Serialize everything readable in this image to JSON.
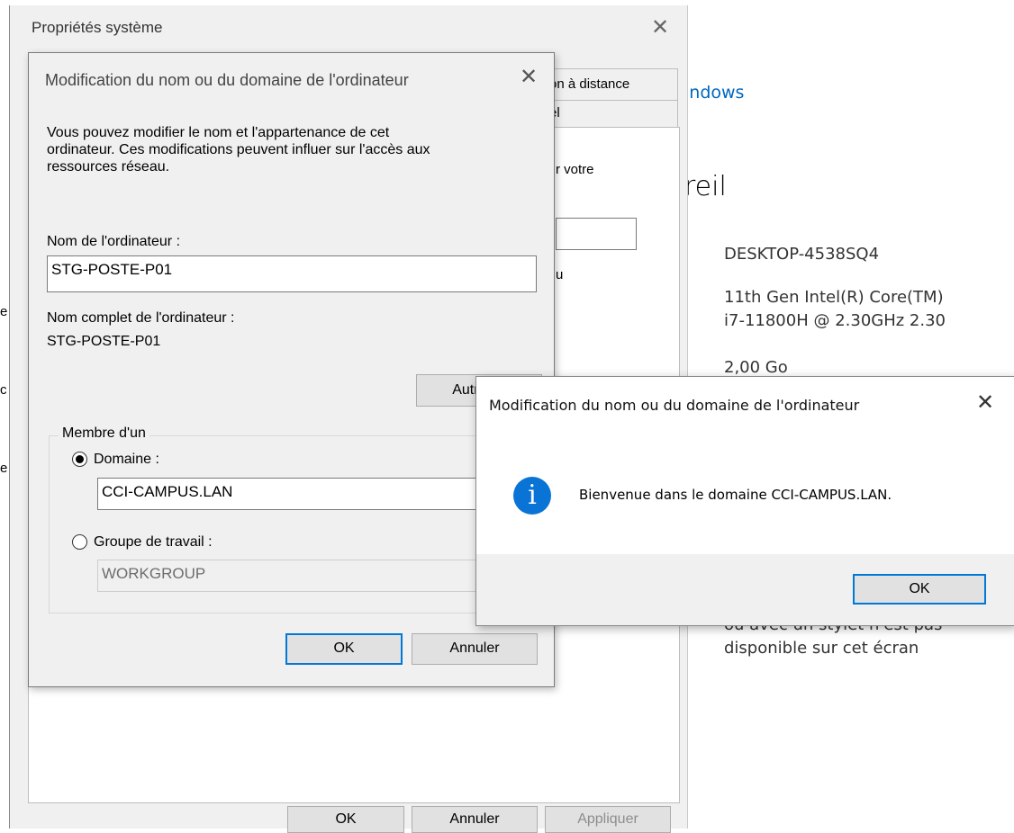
{
  "settings": {
    "link_text": "indows",
    "heading": "reil",
    "device_name": "DESKTOP-4538SQ4",
    "processor_line1": "11th Gen Intel(R) Core(TM)",
    "processor_line2": "i7-11800H @ 2.30GHz   2.30",
    "ram": "2,00 Go",
    "pen_line1": "ou avec un stylet n'est pas",
    "pen_line2": "disponible sur cet écran"
  },
  "system_properties": {
    "title": "Propriétés système",
    "tab_remote": "on à distance",
    "tab_partial": "el",
    "frag_votre": "r votre",
    "frag_u": "u",
    "edge_frags": [
      "e",
      "c",
      "e"
    ],
    "ok_label": "OK",
    "cancel_label": "Annuler",
    "apply_label": "Appliquer"
  },
  "name_dialog": {
    "title": "Modification du nom ou du domaine de l'ordinateur",
    "description_line1": "Vous pouvez modifier le nom et l'appartenance de cet",
    "description_line2": "ordinateur. Ces modifications peuvent influer sur l'accès aux",
    "description_line3": "ressources réseau.",
    "computer_name_label": "Nom de l'ordinateur :",
    "computer_name_value": "STG-POSTE-P01",
    "full_name_label": "Nom complet de l'ordinateur :",
    "full_name_value": "STG-POSTE-P01",
    "more_button": "Autres...",
    "member_of_label": "Membre d'un",
    "domain_label": "Domaine :",
    "domain_value": "CCI-CAMPUS.LAN",
    "workgroup_label": "Groupe de travail :",
    "workgroup_value": "WORKGROUP",
    "ok_label": "OK",
    "cancel_label": "Annuler"
  },
  "message_box": {
    "title": "Modification du nom ou du domaine de l'ordinateur",
    "icon": "info-icon",
    "icon_glyph": "i",
    "message": "Bienvenue dans le domaine CCI-CAMPUS.LAN.",
    "ok_label": "OK"
  },
  "colors": {
    "accent": "#0078d7",
    "info_icon": "#0a74d6",
    "dialog_bg": "#f0f0f0",
    "link": "#0067c0"
  }
}
